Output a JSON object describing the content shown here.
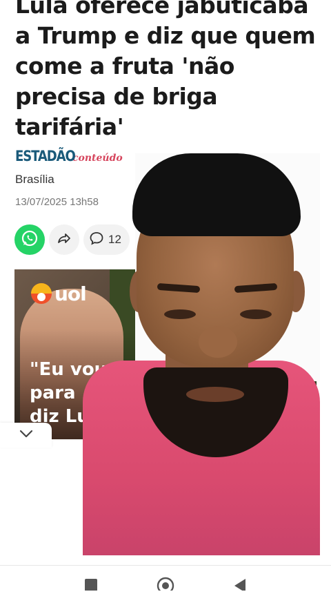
{
  "article": {
    "headline_lines": [
      "Lula oferece jabuticaba",
      "a Trump e diz que quem",
      "come a fruta 'não",
      "precisa de briga",
      "tarifária'"
    ],
    "source_brand": "ESTADÃO",
    "source_tag": "conteúdo",
    "location": "Brasília",
    "datetime": "13/07/2025 13h58",
    "comment_count": "12"
  },
  "hero": {
    "logo_text": "uol",
    "quote_lines": [
      "\"Eu vou l",
      "para",
      "diz Lu"
    ]
  },
  "icons": {
    "whatsapp": "whatsapp-icon",
    "share": "share-icon",
    "comment": "comment-icon",
    "collapse": "chevron-down-icon",
    "nav_recents": "square-icon",
    "nav_home": "circle-icon",
    "nav_back": "triangle-back-icon"
  },
  "colors": {
    "whatsapp": "#25d366",
    "source_brand": "#1a5a7a",
    "source_tag": "#d6455d",
    "uol_logo": "#f0502a"
  }
}
